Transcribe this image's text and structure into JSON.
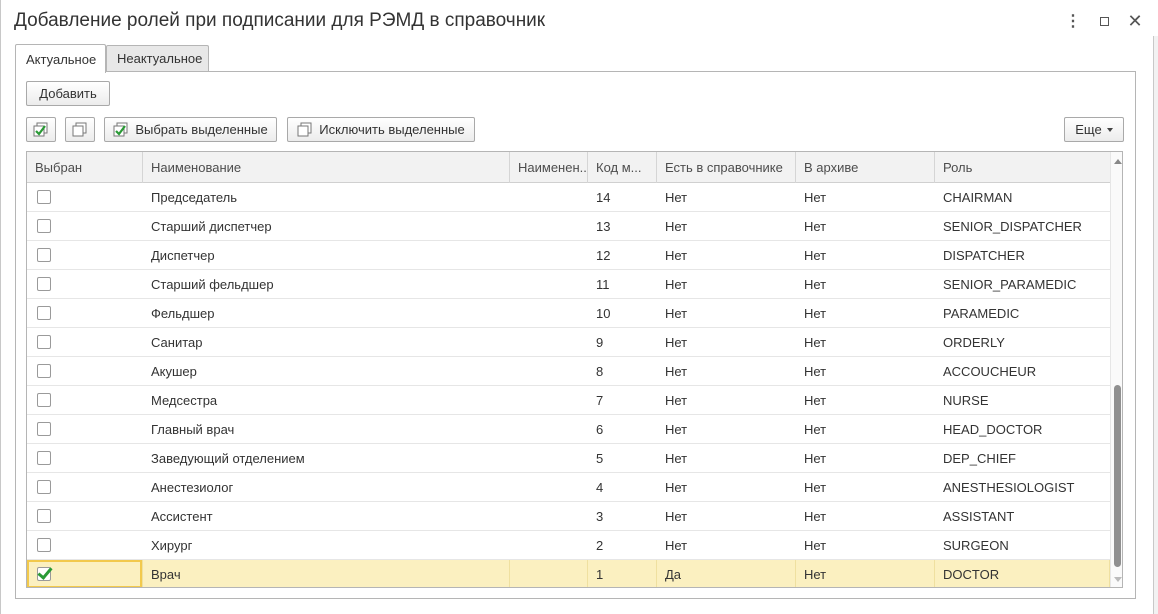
{
  "window": {
    "title": "Добавление ролей при подписании для РЭМД в справочник",
    "kebab": "⋮",
    "close": "✕"
  },
  "tabs": [
    {
      "label": "Актуальное",
      "active": true
    },
    {
      "label": "Неактуальное",
      "active": false
    }
  ],
  "toolbar": {
    "add_label": "Добавить",
    "select_selected_label": "Выбрать выделенные",
    "exclude_selected_label": "Исключить выделенные",
    "more_label": "Еще"
  },
  "table": {
    "columns": [
      "Выбран",
      "Наименование",
      "Наименен...",
      "Код м...",
      "Есть в справочнике",
      "В архиве",
      "Роль"
    ],
    "rows": [
      {
        "checked": false,
        "name": "Председатель",
        "name2": "",
        "code": "14",
        "in_ref": "Нет",
        "archive": "Нет",
        "role": "CHAIRMAN"
      },
      {
        "checked": false,
        "name": "Старший диспетчер",
        "name2": "",
        "code": "13",
        "in_ref": "Нет",
        "archive": "Нет",
        "role": "SENIOR_DISPATCHER"
      },
      {
        "checked": false,
        "name": "Диспетчер",
        "name2": "",
        "code": "12",
        "in_ref": "Нет",
        "archive": "Нет",
        "role": "DISPATCHER"
      },
      {
        "checked": false,
        "name": "Старший фельдшер",
        "name2": "",
        "code": "11",
        "in_ref": "Нет",
        "archive": "Нет",
        "role": "SENIOR_PARAMEDIC"
      },
      {
        "checked": false,
        "name": "Фельдшер",
        "name2": "",
        "code": "10",
        "in_ref": "Нет",
        "archive": "Нет",
        "role": "PARAMEDIC"
      },
      {
        "checked": false,
        "name": "Санитар",
        "name2": "",
        "code": "9",
        "in_ref": "Нет",
        "archive": "Нет",
        "role": "ORDERLY"
      },
      {
        "checked": false,
        "name": "Акушер",
        "name2": "",
        "code": "8",
        "in_ref": "Нет",
        "archive": "Нет",
        "role": "ACCOUCHEUR"
      },
      {
        "checked": false,
        "name": "Медсестра",
        "name2": "",
        "code": "7",
        "in_ref": "Нет",
        "archive": "Нет",
        "role": "NURSE"
      },
      {
        "checked": false,
        "name": "Главный врач",
        "name2": "",
        "code": "6",
        "in_ref": "Нет",
        "archive": "Нет",
        "role": "HEAD_DOCTOR"
      },
      {
        "checked": false,
        "name": "Заведующий отделением",
        "name2": "",
        "code": "5",
        "in_ref": "Нет",
        "archive": "Нет",
        "role": "DEP_CHIEF"
      },
      {
        "checked": false,
        "name": "Анестезиолог",
        "name2": "",
        "code": "4",
        "in_ref": "Нет",
        "archive": "Нет",
        "role": "ANESTHESIOLOGIST"
      },
      {
        "checked": false,
        "name": "Ассистент",
        "name2": "",
        "code": "3",
        "in_ref": "Нет",
        "archive": "Нет",
        "role": "ASSISTANT"
      },
      {
        "checked": false,
        "name": "Хирург",
        "name2": "",
        "code": "2",
        "in_ref": "Нет",
        "archive": "Нет",
        "role": "SURGEON"
      },
      {
        "checked": true,
        "name": "Врач",
        "name2": "",
        "code": "1",
        "in_ref": "Да",
        "archive": "Нет",
        "role": "DOCTOR",
        "selected": true
      }
    ]
  },
  "colors": {
    "selected_row": "#fbf0c0",
    "focus_border": "#f2c94c",
    "check_green": "#2a9a36"
  }
}
